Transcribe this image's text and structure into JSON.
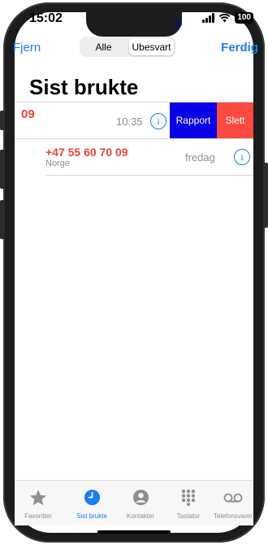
{
  "status": {
    "time": "15:02",
    "battery": "100"
  },
  "nav": {
    "left": "Fjern",
    "right": "Ferdig",
    "segments": [
      {
        "label": "Alle",
        "active": false
      },
      {
        "label": "Ubesvart",
        "active": true
      }
    ]
  },
  "title": "Sist brukte",
  "calls": [
    {
      "number": "09",
      "time": "10:35",
      "actions": {
        "report": "Rapport",
        "delete": "Slett"
      }
    },
    {
      "number": "+47 55 60 70 09",
      "country": "Norge",
      "time": "fredag"
    }
  ],
  "tabs": [
    {
      "label": "Favoritter",
      "icon": "star-icon",
      "active": false
    },
    {
      "label": "Sist brukte",
      "icon": "clock-icon",
      "active": true
    },
    {
      "label": "Kontakter",
      "icon": "person-icon",
      "active": false
    },
    {
      "label": "Tastatur",
      "icon": "keypad-icon",
      "active": false
    },
    {
      "label": "Telefonsvarer",
      "icon": "voicemail-icon",
      "active": false
    }
  ],
  "colors": {
    "accent": "#1a7ef0",
    "missed": "#e8453c",
    "report": "#0a00e8",
    "delete": "#fc4a40"
  }
}
